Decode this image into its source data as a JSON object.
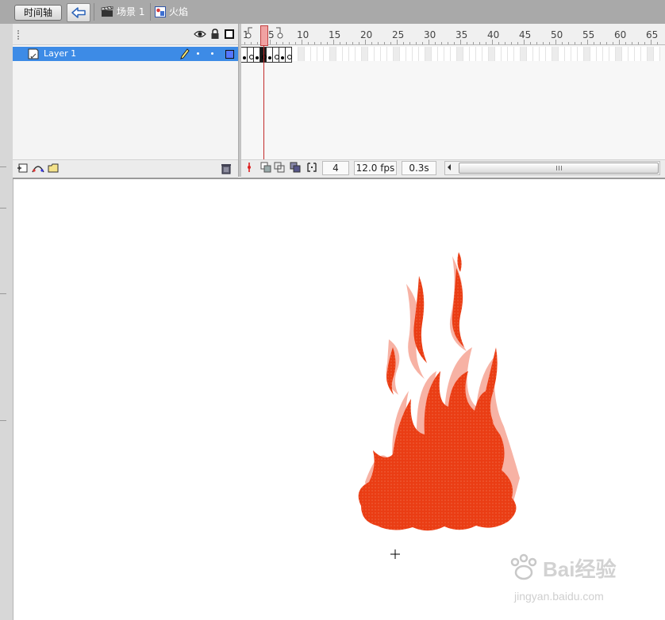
{
  "tabbar": {
    "timeline_label": "时间轴",
    "scene_label": "场景 1",
    "symbol_label": "火焰"
  },
  "layers": [
    {
      "name": "Layer 1",
      "selected": true
    }
  ],
  "ruler_ticks": [
    "1",
    "5",
    "10",
    "15",
    "20",
    "25",
    "30",
    "35",
    "40",
    "45",
    "50",
    "55",
    "60",
    "65"
  ],
  "status": {
    "current_frame": "4",
    "frame_rate": "12.0 fps",
    "elapsed_time": "0.3s"
  },
  "watermark": {
    "logo_text": "Bai经验",
    "url_text": "jingyan.baidu.com"
  },
  "colors": {
    "tabbar": "#a9a9a9",
    "selected_layer": "#3d8be6",
    "playhead": "#e75b5b",
    "flame_main": "#ea3d14",
    "flame_light": "#f7b2a4"
  },
  "icons": {
    "back": "arrow-left-icon",
    "scene": "clapperboard-icon",
    "symbol": "movieclip-icon",
    "eye": "eye-icon",
    "lock": "lock-icon",
    "outline": "outline-square-icon",
    "pencil": "pencil-icon",
    "trash": "trash-icon"
  }
}
